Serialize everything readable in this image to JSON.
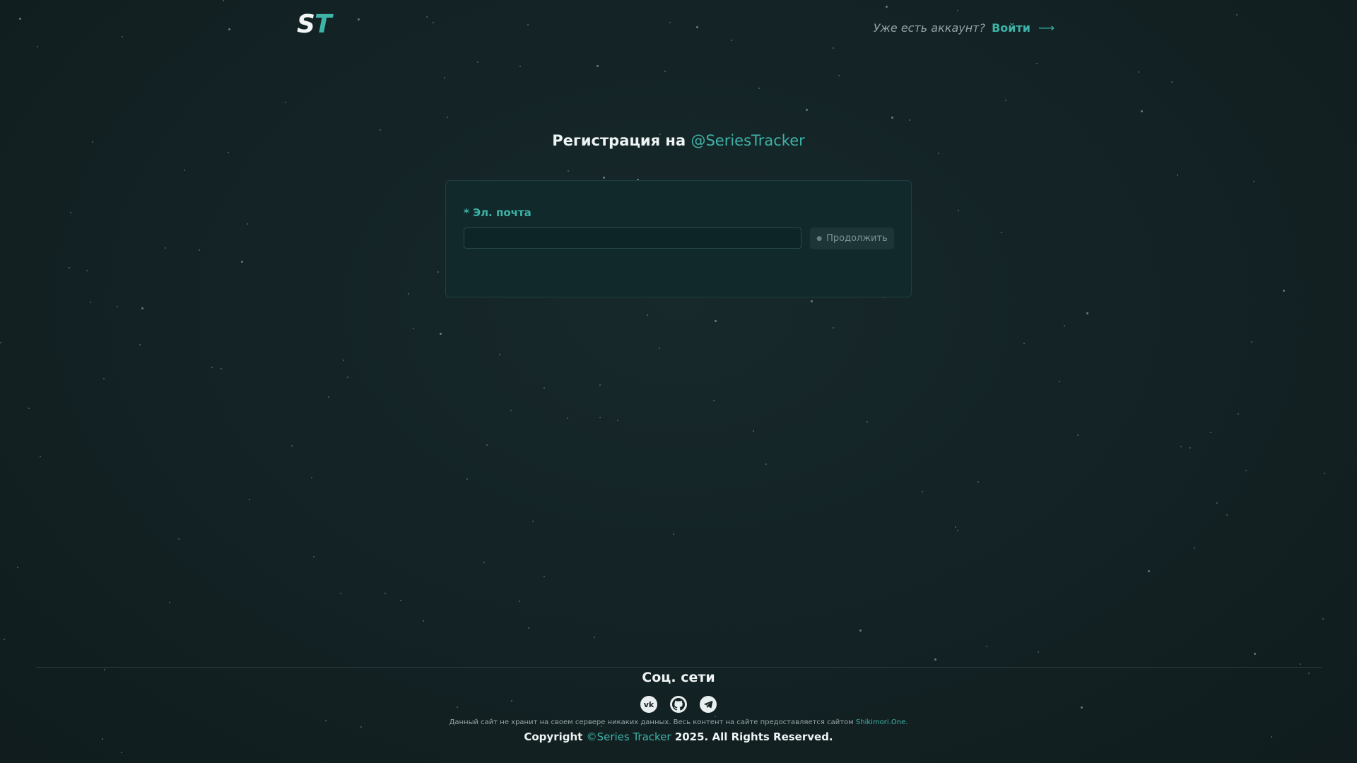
{
  "header": {
    "logo_s": "S",
    "logo_t": "T",
    "account_question": "Уже есть аккаунт?",
    "login_label": "Войти",
    "arrow_icon": "arrow-right-icon"
  },
  "main": {
    "title_prefix": "Регистрация на",
    "title_brand": "@SeriesTracker",
    "email_label": "* Эл. почта",
    "email_value": "",
    "email_placeholder": "",
    "continue_label": "Продолжить"
  },
  "footer": {
    "social_title": "Соц. сети",
    "social_icons": [
      "vk-icon",
      "github-icon",
      "telegram-icon"
    ],
    "disclaimer_text": "Данный сайт не хранит на своем сервере никаких данных. Весь контент на сайте предоставляется сайтом",
    "disclaimer_link": "Shikimori.One.",
    "copyright_prefix": "Copyright",
    "copyright_brand": "©Series Tracker",
    "copyright_suffix": "2025. All Rights Reserved."
  },
  "colors": {
    "accent": "#3eb3a8",
    "background": "#132224",
    "card": "#11292b"
  }
}
